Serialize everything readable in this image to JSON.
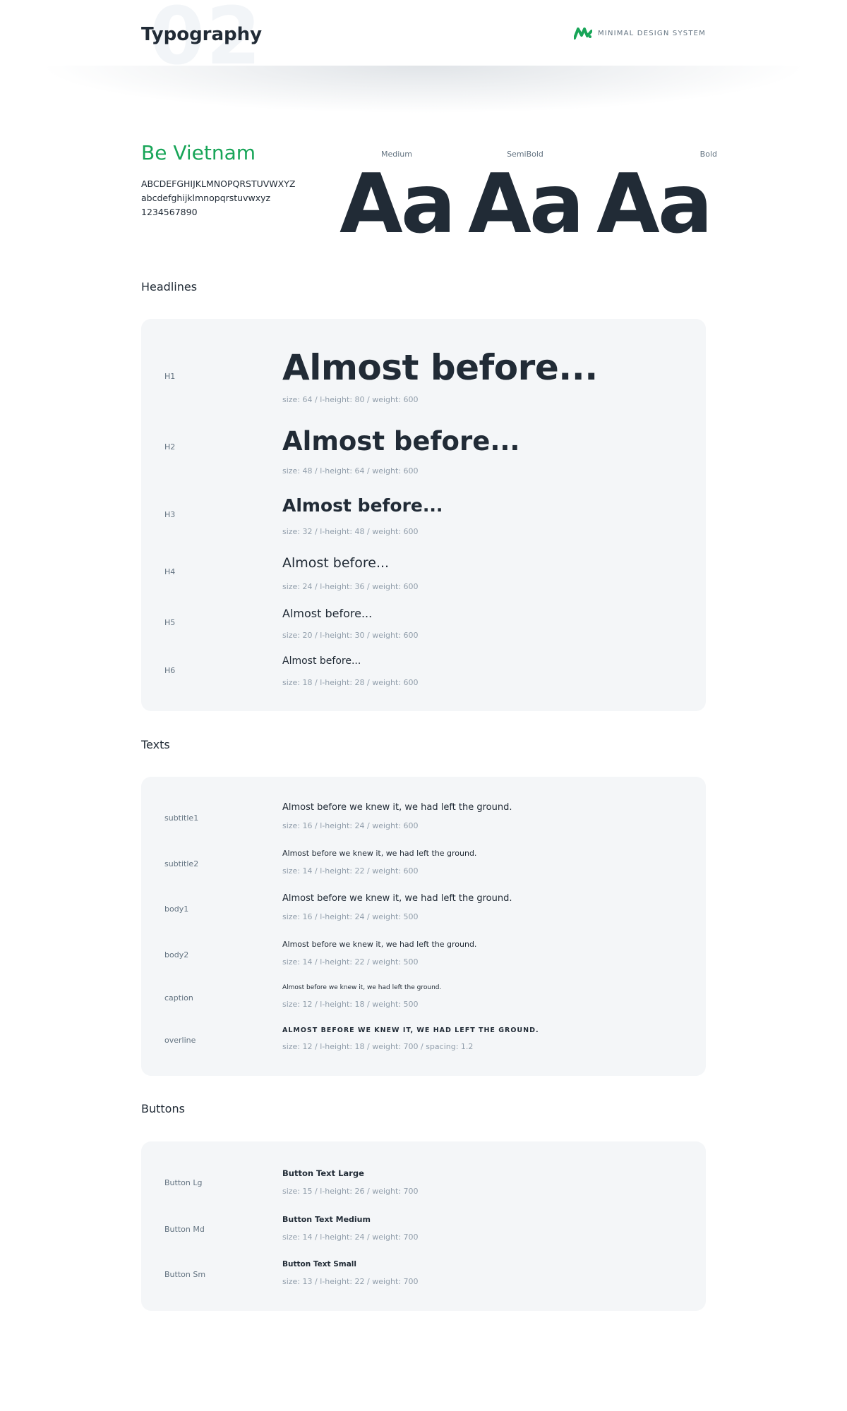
{
  "header": {
    "watermark": "02",
    "title": "Typography",
    "brand_text": "MINIMAL DESIGN SYSTEM",
    "brand_icon": "minimal-logo-icon",
    "brand_color": "#18a558"
  },
  "font": {
    "name": "Be Vietnam",
    "uppercase": "ABCDEFGHIJKLMNOPQRSTUVWXYZ",
    "lowercase": "abcdefghijklmnopqrstuvwxyz",
    "digits": "1234567890",
    "weights": [
      {
        "label": "Medium",
        "sample": "Aa"
      },
      {
        "label": "SemiBold",
        "sample": "Aa"
      },
      {
        "label": "Bold",
        "sample": "Aa"
      }
    ]
  },
  "headlines": {
    "title": "Headlines",
    "items": [
      {
        "label": "H1",
        "sample": "Almost before...",
        "meta": "size: 64 / l-height: 80 / weight: 600"
      },
      {
        "label": "H2",
        "sample": "Almost before...",
        "meta": "size: 48 / l-height: 64 / weight: 600"
      },
      {
        "label": "H3",
        "sample": "Almost before...",
        "meta": "size: 32 / l-height: 48 / weight: 600"
      },
      {
        "label": "H4",
        "sample": "Almost before...",
        "meta": "size: 24 / l-height: 36 / weight: 600"
      },
      {
        "label": "H5",
        "sample": "Almost before...",
        "meta": "size: 20 / l-height: 30 / weight: 600"
      },
      {
        "label": "H6",
        "sample": "Almost before...",
        "meta": "size: 18 / l-height: 28 / weight: 600"
      }
    ]
  },
  "texts": {
    "title": "Texts",
    "items": [
      {
        "label": "subtitle1",
        "sample": "Almost before we knew it, we had left the ground.",
        "meta": "size: 16 / l-height: 24 / weight: 600"
      },
      {
        "label": "subtitle2",
        "sample": "Almost before we knew it, we had left the ground.",
        "meta": "size: 14 / l-height: 22 / weight: 600"
      },
      {
        "label": "body1",
        "sample": "Almost before we knew it, we had left the ground.",
        "meta": "size: 16 / l-height: 24 / weight: 500"
      },
      {
        "label": "body2",
        "sample": "Almost before we knew it, we had left the ground.",
        "meta": "size: 14 / l-height: 22 / weight: 500"
      },
      {
        "label": "caption",
        "sample": "Almost before we knew it, we had left the ground.",
        "meta": "size: 12 / l-height: 18 / weight: 500"
      },
      {
        "label": "overline",
        "sample": "ALMOST BEFORE WE KNEW IT, WE HAD LEFT THE GROUND.",
        "meta": "size: 12 / l-height: 18 / weight: 700 / spacing: 1.2"
      }
    ]
  },
  "buttons": {
    "title": "Buttons",
    "items": [
      {
        "label": "Button Lg",
        "sample": "Button Text Large",
        "meta": "size: 15 / l-height: 26 / weight: 700"
      },
      {
        "label": "Button Md",
        "sample": "Button Text Medium",
        "meta": "size: 14 / l-height: 24 / weight: 700"
      },
      {
        "label": "Button Sm",
        "sample": "Button Text Small",
        "meta": "size: 13 / l-height: 22 / weight: 700"
      }
    ]
  }
}
